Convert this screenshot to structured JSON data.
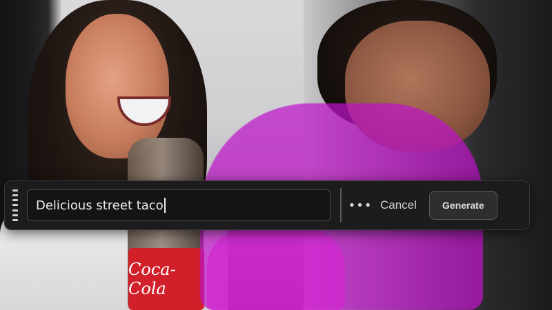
{
  "prompt": {
    "value": "Delicious street taco",
    "more_label": "•••",
    "cancel_label": "Cancel",
    "generate_label": "Generate"
  },
  "photo": {
    "bottle_label": "Coca-Cola"
  },
  "colors": {
    "bar_background": "#1c1c1e",
    "selection_overlay": "#be14c8"
  }
}
